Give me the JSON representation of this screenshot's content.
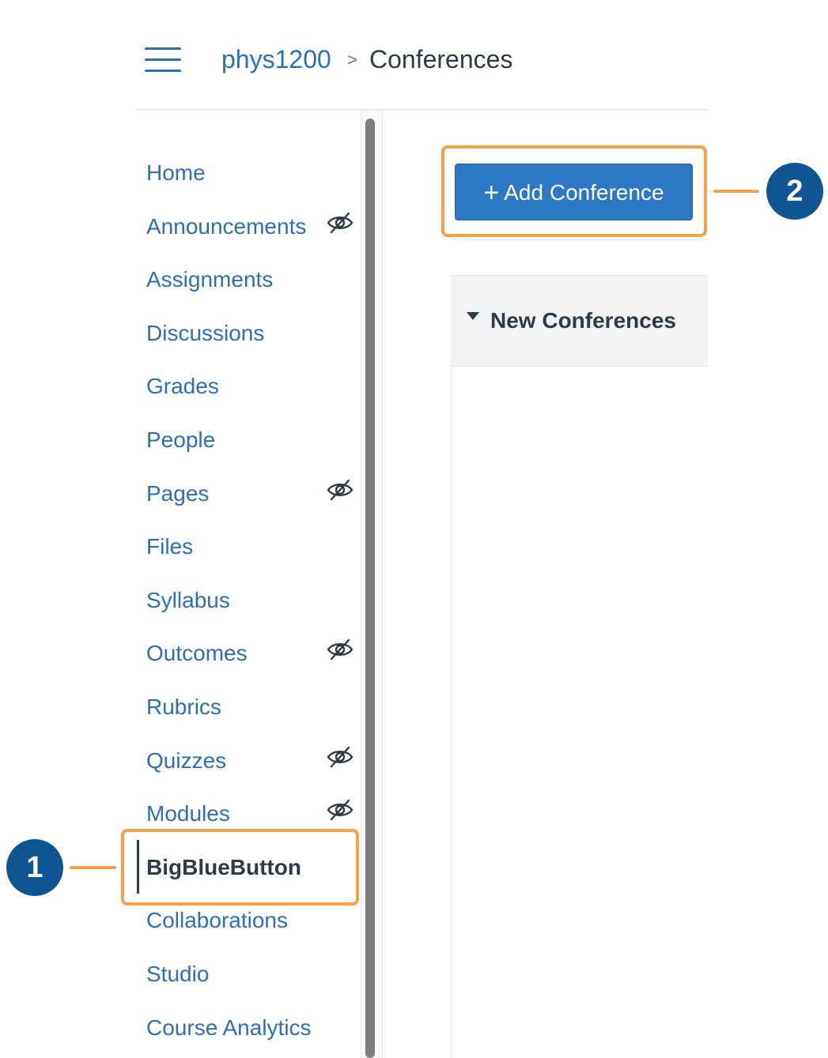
{
  "header": {
    "course": "phys1200",
    "separator": ">",
    "page": "Conferences"
  },
  "sidebar": {
    "items": [
      {
        "label": "Home",
        "hidden_icon": false
      },
      {
        "label": "Announcements",
        "hidden_icon": true
      },
      {
        "label": "Assignments",
        "hidden_icon": false
      },
      {
        "label": "Discussions",
        "hidden_icon": false
      },
      {
        "label": "Grades",
        "hidden_icon": false
      },
      {
        "label": "People",
        "hidden_icon": false
      },
      {
        "label": "Pages",
        "hidden_icon": true
      },
      {
        "label": "Files",
        "hidden_icon": false
      },
      {
        "label": "Syllabus",
        "hidden_icon": false
      },
      {
        "label": "Outcomes",
        "hidden_icon": true
      },
      {
        "label": "Rubrics",
        "hidden_icon": false
      },
      {
        "label": "Quizzes",
        "hidden_icon": true
      },
      {
        "label": "Modules",
        "hidden_icon": true
      },
      {
        "label": "BigBlueButton",
        "hidden_icon": false,
        "active": true
      },
      {
        "label": "Collaborations",
        "hidden_icon": false
      },
      {
        "label": "Studio",
        "hidden_icon": false
      },
      {
        "label": "Course Analytics",
        "hidden_icon": false
      }
    ]
  },
  "main": {
    "add_button": {
      "icon": "plus-icon",
      "label": "Add Conference"
    },
    "section": {
      "toggle_icon": "caret-down-icon",
      "title": "New Conferences"
    }
  },
  "callouts": [
    {
      "number": "1",
      "target": "BigBlueButton"
    },
    {
      "number": "2",
      "target": "Add Conference"
    }
  ],
  "colors": {
    "link": "#2d6fb5",
    "text": "#2d3b45",
    "button": "#2d78c4",
    "callout": "#f5a04a",
    "badge": "#0f5594"
  }
}
